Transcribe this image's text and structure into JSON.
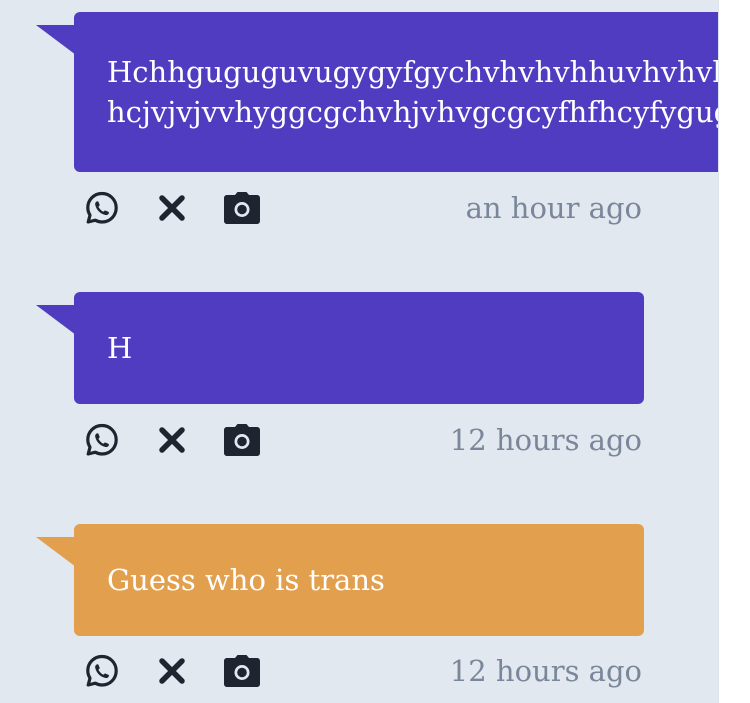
{
  "posts": [
    {
      "lines": [
        "Hchhguguguvugygyfgychvhvhvhhuvhvhvhvhvh",
        "hcjvjvjvvhyggcgchvhjvhvgcgcyfhfhcyfygugvhvh"
      ],
      "time": "an hour ago",
      "color": "#4f3cc0"
    },
    {
      "lines": [
        "H"
      ],
      "time": "12 hours ago",
      "color": "#4f3cc0"
    },
    {
      "lines": [
        "Guess who is trans"
      ],
      "time": "12 hours ago",
      "color": "#e29f4d"
    }
  ],
  "icons": {
    "share": "whatsapp-icon",
    "delete": "close-icon",
    "photo": "camera-icon"
  },
  "colors": {
    "background": "#e2e8f0",
    "timestamp": "#7a8699",
    "icon": "#1f2530"
  }
}
